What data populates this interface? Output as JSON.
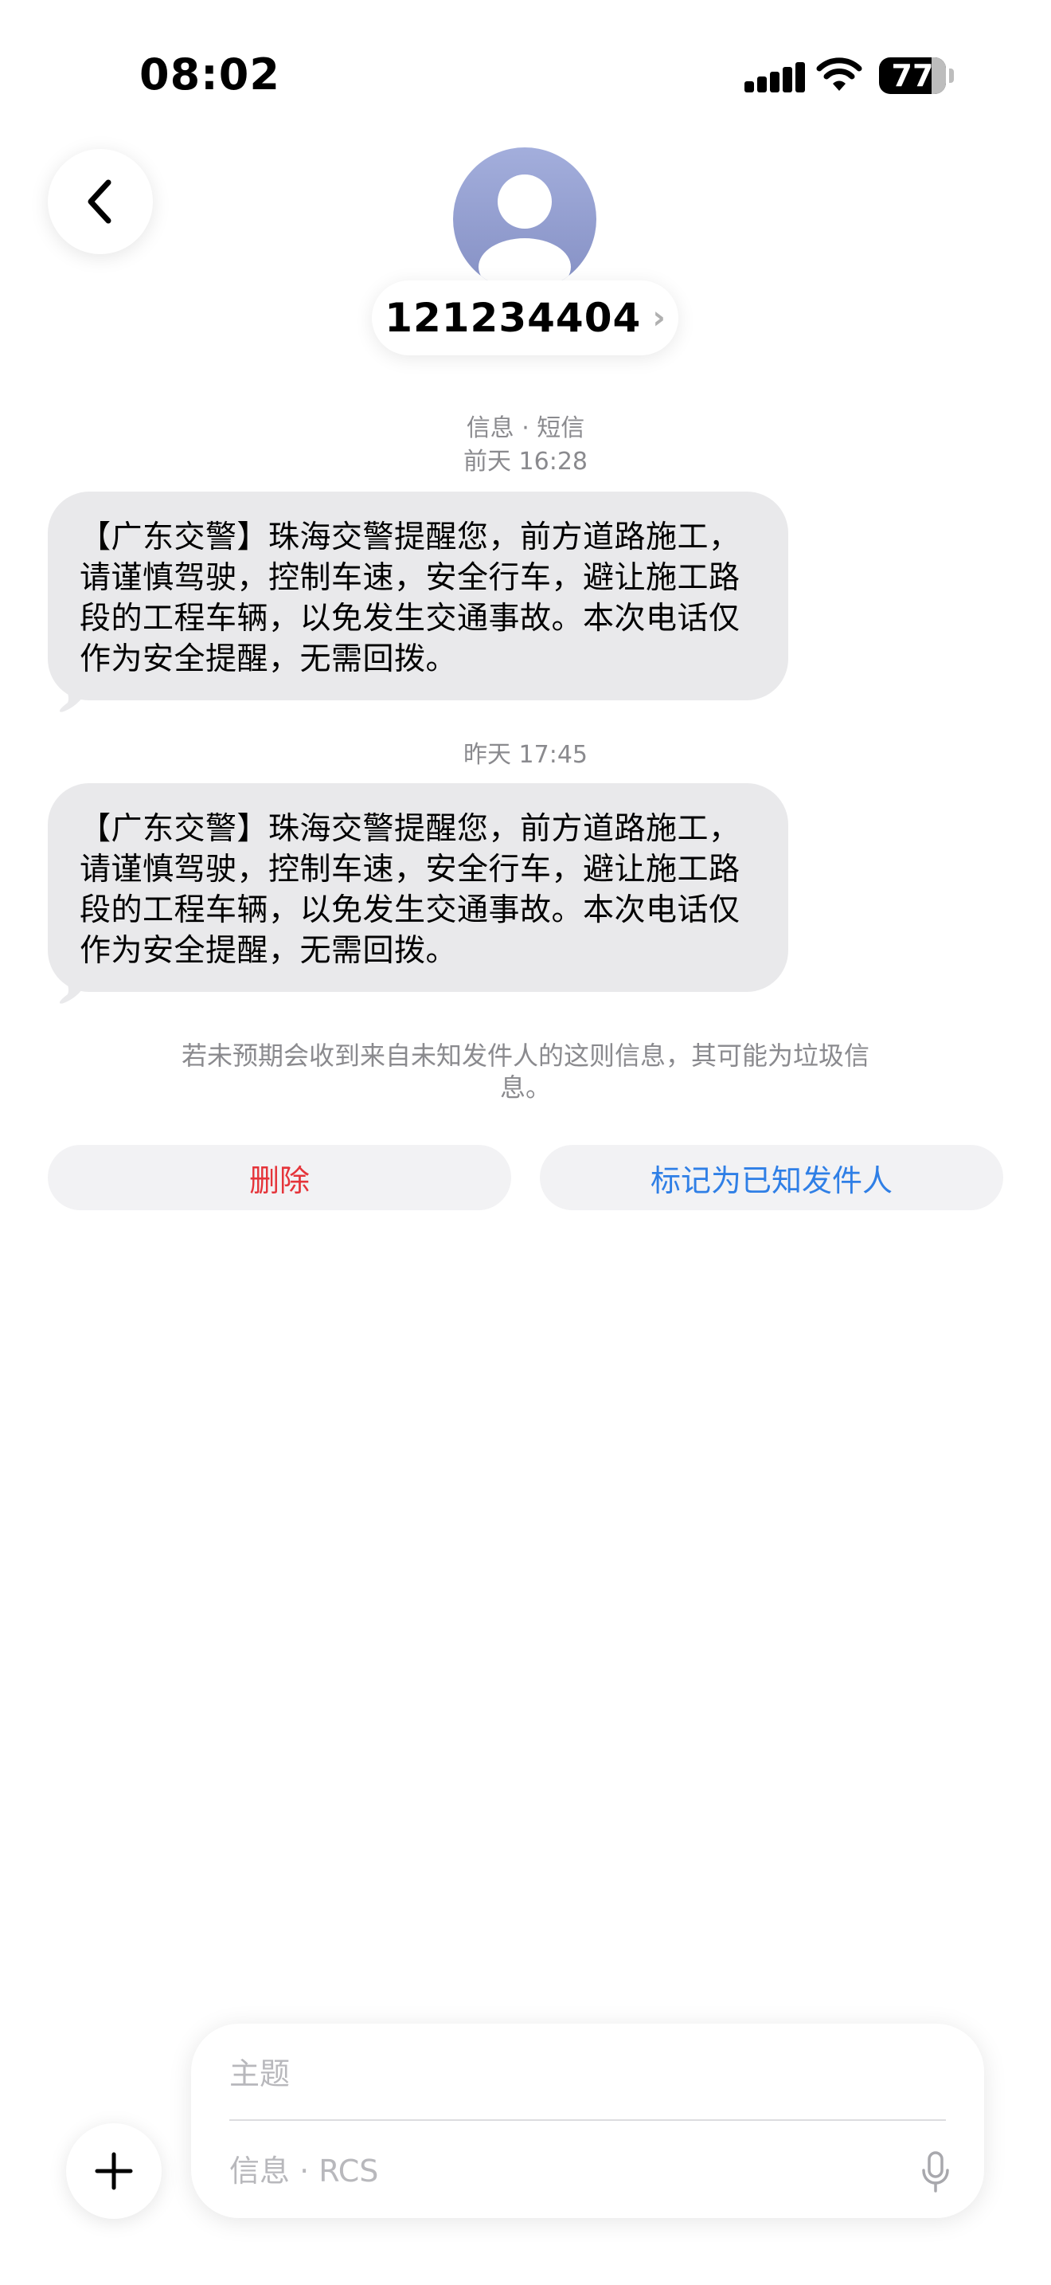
{
  "status_bar": {
    "time": "08:02",
    "battery": "77"
  },
  "header": {
    "contact_name": "121234404",
    "chevron": "›"
  },
  "conversation": {
    "service_label": "信息 · 短信",
    "groups": [
      {
        "timestamp": "前天 16:28",
        "message": "【广东交警】珠海交警提醒您，前方道路施工，请谨慎驾驶，控制车速，安全行车，避让施工路段的工程车辆，以免发生交通事故。本次电话仅作为安全提醒，无需回拨。"
      },
      {
        "timestamp": "昨天 17:45",
        "message": "【广东交警】珠海交警提醒您，前方道路施工，请谨慎驾驶，控制车速，安全行车，避让施工路段的工程车辆，以免发生交通事故。本次电话仅作为安全提醒，无需回拨。"
      }
    ]
  },
  "unknown_sender": {
    "notice": "若未预期会收到来自未知发件人的这则信息，其可能为垃圾信息。",
    "delete_label": "删除",
    "mark_known_label": "标记为已知发件人"
  },
  "composer": {
    "subject_placeholder": "主题",
    "message_placeholder": "信息 · RCS"
  },
  "colors": {
    "delete": "#e5343a",
    "accent": "#2f7fe6",
    "bubble": "#e9e9eb"
  },
  "icons": [
    "signal-icon",
    "wifi-icon",
    "battery-icon",
    "back-chevron-icon",
    "person-icon",
    "plus-icon",
    "microphone-icon"
  ]
}
